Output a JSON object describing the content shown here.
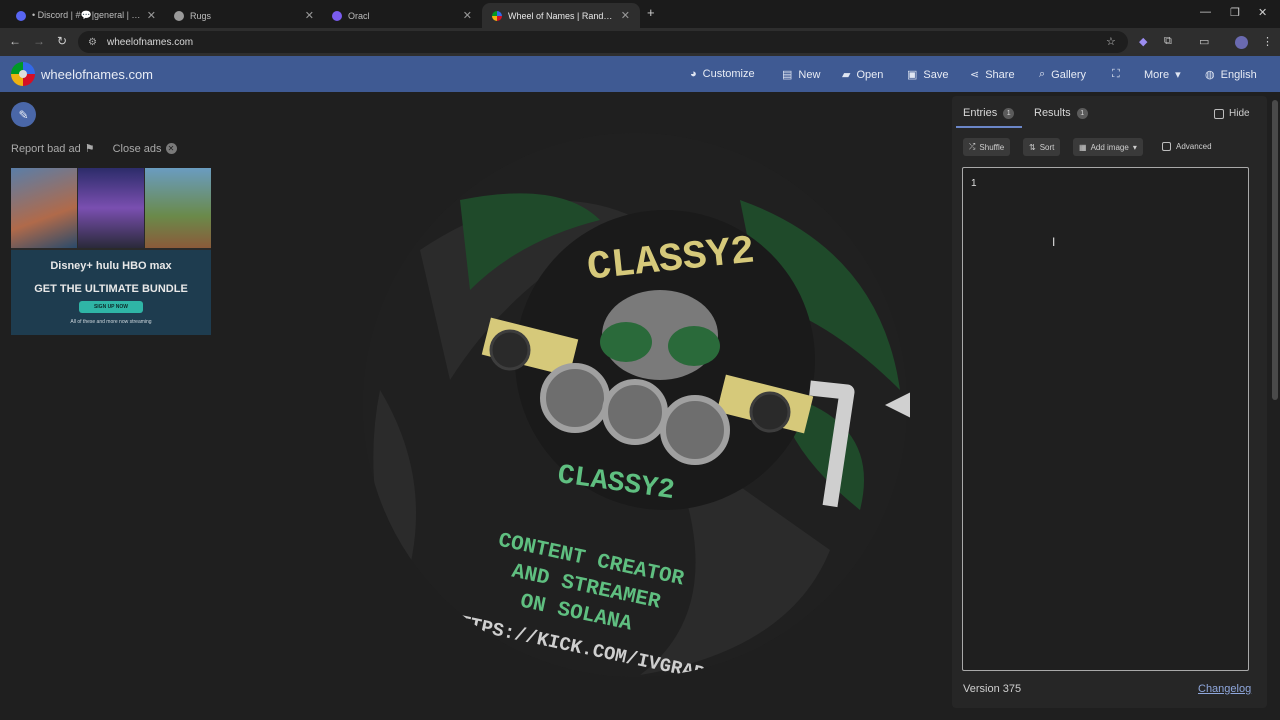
{
  "browser": {
    "tabs": [
      {
        "title": "• Discord | #💬|general | rugs",
        "color": "#5865f2"
      },
      {
        "title": "Rugs",
        "color": "#9a9a9a"
      },
      {
        "title": "Oracl",
        "color": "#7a5cf0"
      },
      {
        "title": "Wheel of Names | Random nam",
        "color": "#e8a21b"
      }
    ],
    "new_tab_label": "+",
    "url": "wheelofnames.com"
  },
  "app": {
    "brand": "wheelofnames.com",
    "menu": {
      "customize": "Customize",
      "new": "New",
      "open": "Open",
      "save": "Save",
      "share": "Share",
      "gallery": "Gallery",
      "more": "More",
      "language": "English"
    }
  },
  "ads": {
    "report": "Report bad ad",
    "close": "Close ads",
    "banner_logos": "Disney+  hulu  HBO max",
    "banner_headline": "GET THE ULTIMATE BUNDLE",
    "banner_cta": "SIGN UP NOW",
    "banner_fine": "All of these and more now streaming"
  },
  "wheel": {
    "texts": {
      "top": "CLASSY2",
      "middle": "CLASSY2",
      "line1": "CONTENT CREATOR",
      "line2": "AND STREAMER",
      "line3": "ON SOLANA",
      "url": "HTTPS://KICK.COM/IVGRAB"
    },
    "segment_label": "1",
    "colors": {
      "dark": "#1f1f1f",
      "green": "#1f4a2a",
      "accent": "#d6c97a",
      "text_green": "#5fbf80"
    }
  },
  "panel": {
    "entries_tab": "Entries",
    "entries_count": "1",
    "results_tab": "Results",
    "results_count": "1",
    "hide_label": "Hide",
    "shuffle": "Shuffle",
    "sort": "Sort",
    "add_image": "Add image",
    "advanced": "Advanced",
    "entries_text": "1",
    "version": "Version 375",
    "changelog": "Changelog"
  }
}
